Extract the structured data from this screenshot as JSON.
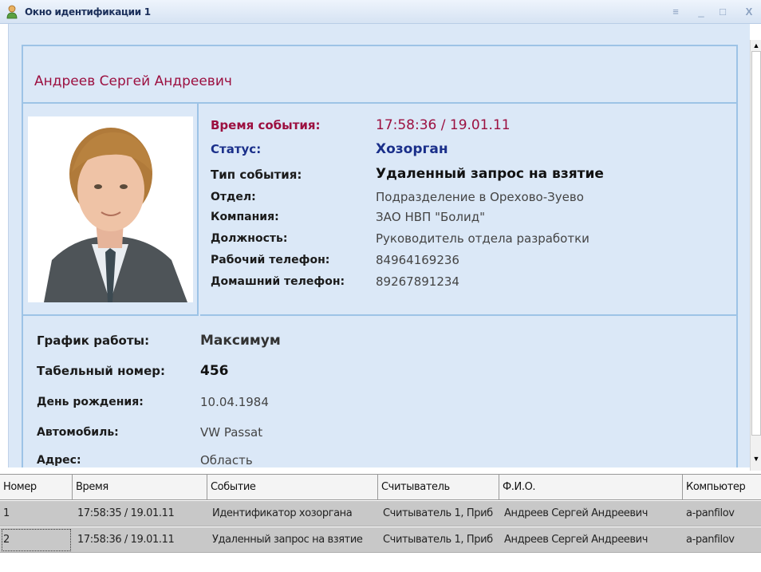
{
  "window": {
    "title": "Окно идентификации 1",
    "buttons": {
      "menu": "≡",
      "minimize": "_",
      "maximize": "□",
      "close": "X"
    }
  },
  "person": {
    "name": "Андреев  Сергей  Андреевич"
  },
  "event": [
    {
      "label": "Время события:",
      "value": "17:58:36 / 19.01.11",
      "style": "red"
    },
    {
      "label": "Статус:",
      "value": "Хозорган",
      "style": "blue"
    },
    {
      "label": "Тип события:",
      "value": "Удаленный запрос на взятие",
      "style": "bold"
    },
    {
      "label": "Отдел:",
      "value": "Подразделение в Орехово-Зуево",
      "style": "normal"
    },
    {
      "label": "Компания:",
      "value": "ЗАО НВП \"Болид\"",
      "style": "normal"
    },
    {
      "label": "Должность:",
      "value": "Руководитель отдела разработки",
      "style": "normal"
    },
    {
      "label": "Рабочий телефон:",
      "value": "84964169236",
      "style": "normal"
    },
    {
      "label": "Домашний телефон:",
      "value": "89267891234",
      "style": "normal"
    }
  ],
  "details": [
    {
      "label": "График работы:",
      "value": "Максимум",
      "style": "bold"
    },
    {
      "label": "Табельный номер:",
      "value": "456",
      "style": "bold"
    },
    {
      "label": "День рождения:",
      "value": "10.04.1984",
      "style": "normal"
    },
    {
      "label": "Автомобиль:",
      "value": "VW Passat",
      "style": "normal"
    },
    {
      "label": "Адрес:",
      "value": "Область",
      "style": "normal"
    }
  ],
  "table": {
    "columns": [
      "Номер",
      "Время",
      "Событие",
      "Считыватель",
      "Ф.И.О.",
      "Компьютер"
    ],
    "rows": [
      [
        "1",
        "17:58:35 / 19.01.11",
        "Идентификатор хозоргана",
        "Считыватель 1, Приб",
        "Андреев Сергей Андреевич",
        "a-panfilov"
      ],
      [
        "2",
        "17:58:36 / 19.01.11",
        "Удаленный запрос на взятие",
        "Считыватель 1, Приб",
        "Андреев Сергей Андреевич",
        "a-panfilov"
      ]
    ]
  },
  "colors": {
    "card_background": "#dbe8f7",
    "card_border": "#9dc3e6",
    "accent_red": "#9c1040",
    "accent_blue": "#1a2f8a"
  }
}
